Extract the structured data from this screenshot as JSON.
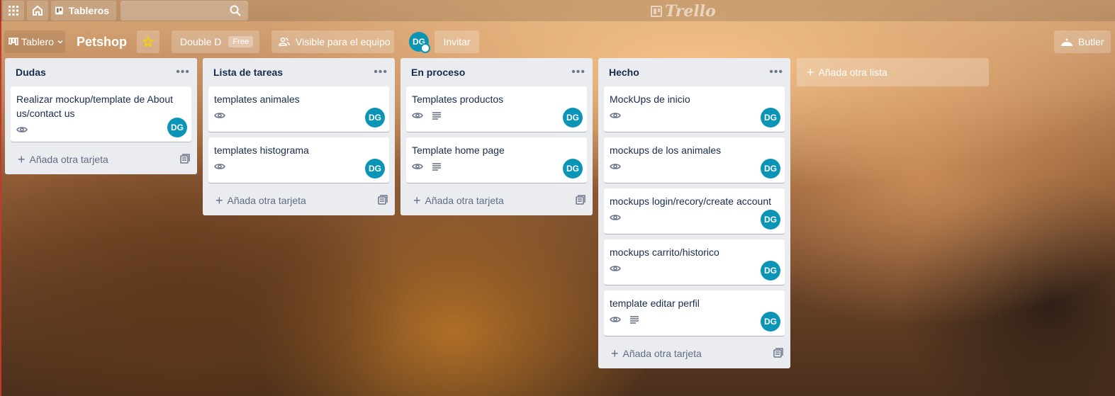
{
  "topbar": {
    "apps_icon": "apps-grid-icon",
    "home_icon": "home-icon",
    "boards_label": "Tableros",
    "search_placeholder": "",
    "logo": "Trello"
  },
  "board": {
    "view_label": "Tablero",
    "title": "Petshop",
    "team_name": "Double D",
    "team_badge": "Free",
    "visibility": "Visible para el equipo",
    "member_initials": "DG",
    "invite_label": "Invitar",
    "butler_label": "Butler"
  },
  "lists": [
    {
      "title": "Dudas",
      "cards": [
        {
          "title": "Realizar mockup/template de About us/contact us",
          "watch": true,
          "description": false,
          "member": "DG"
        }
      ],
      "add_card": "Añada otra tarjeta"
    },
    {
      "title": "Lista de tareas",
      "cards": [
        {
          "title": "templates animales",
          "watch": true,
          "description": false,
          "member": "DG"
        },
        {
          "title": "templates histograma",
          "watch": true,
          "description": false,
          "member": "DG"
        }
      ],
      "add_card": "Añada otra tarjeta"
    },
    {
      "title": "En proceso",
      "cards": [
        {
          "title": "Templates productos",
          "watch": true,
          "description": true,
          "member": "DG"
        },
        {
          "title": "Template home page",
          "watch": true,
          "description": true,
          "member": "DG"
        }
      ],
      "add_card": "Añada otra tarjeta"
    },
    {
      "title": "Hecho",
      "cards": [
        {
          "title": "MockUps de inicio",
          "watch": true,
          "description": false,
          "member": "DG"
        },
        {
          "title": "mockups de los animales",
          "watch": true,
          "description": false,
          "member": "DG"
        },
        {
          "title": "mockups login/recory/create account",
          "watch": true,
          "description": false,
          "member": "DG"
        },
        {
          "title": "mockups carrito/historico",
          "watch": true,
          "description": false,
          "member": "DG"
        },
        {
          "title": "template editar perfil",
          "watch": true,
          "description": true,
          "member": "DG"
        }
      ],
      "add_card": "Añada otra tarjeta"
    }
  ],
  "add_list_label": "Añada otra lista",
  "colors": {
    "avatar": "#0a95b6",
    "list_bg": "#ebecf0",
    "card_text": "#172b4d"
  }
}
